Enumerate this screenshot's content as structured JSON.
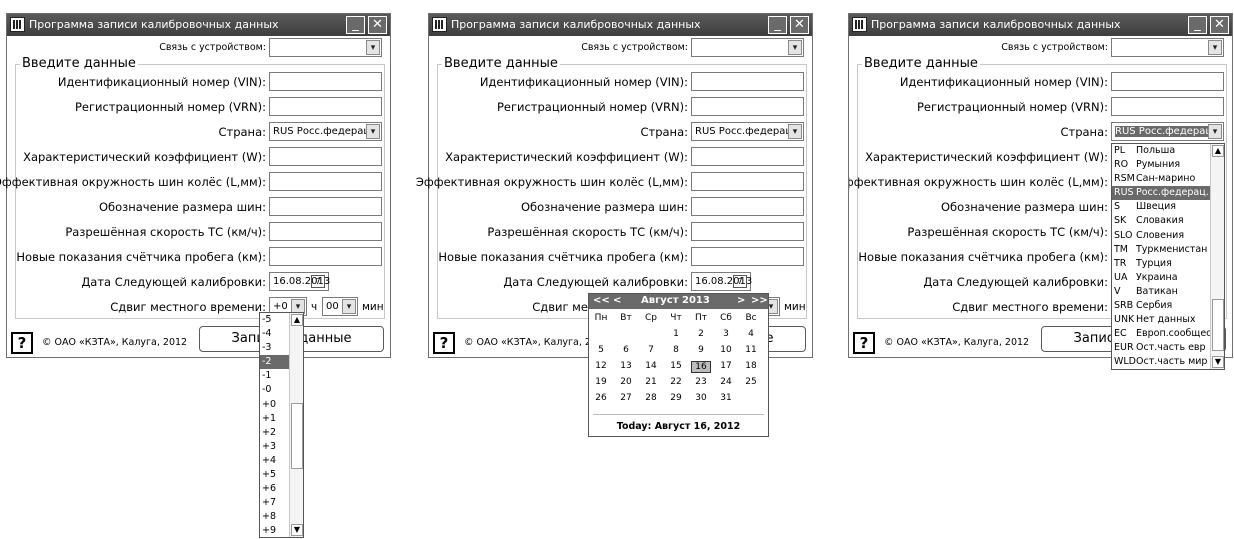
{
  "app": {
    "title": "Программа записи калибровочных данных",
    "minimize_glyph": "_",
    "close_glyph": "✕"
  },
  "form": {
    "device_label": "Связь с устройством:",
    "group_title": "Введите данные",
    "vin_label": "Идентификационный номер (VIN):",
    "vrn_label": "Регистрационный номер (VRN):",
    "country_label": "Страна:",
    "country_value": "RUS  Росс.федерац",
    "w_label": "Характеристический коэффициент (W):",
    "l_label": "Эффективная окружность шин колёс (L,мм):",
    "tire_label": "Обозначение размера шин:",
    "speed_label": "Разрешённая скорость ТС (км/ч):",
    "odometer_label": "Новые показания счётчика пробега (км):",
    "next_cal_label": "Дата Следующей калибровки:",
    "next_cal_value": "16.08.2013",
    "tz_label": "Сдвиг местного времени:",
    "tz_hours": "+0",
    "hours_unit": "ч",
    "tz_minutes": "00",
    "minutes_unit": "мин",
    "help_label": "?",
    "copyright": "© ОАО «КЗТА», Калуга, 2012",
    "record_button": "Записать данные",
    "calendar_glyph": "7",
    "dropdown_glyph": "▾"
  },
  "hour_list": {
    "items": [
      "-5",
      "-4",
      "-3",
      "-2",
      "-1",
      "-0",
      "+0",
      "+1",
      "+2",
      "+3",
      "+4",
      "+5",
      "+6",
      "+7",
      "+8",
      "+9"
    ],
    "selected_index": 3
  },
  "calendar": {
    "prev_year": "<<",
    "prev_month": "<",
    "month_year": "Август 2013",
    "next_month": ">",
    "next_year": ">>",
    "weekdays": [
      "Пн",
      "Вт",
      "Ср",
      "Чт",
      "Пт",
      "Сб",
      "Вс"
    ],
    "weeks": [
      [
        "",
        "",
        "",
        "1",
        "2",
        "3",
        "4"
      ],
      [
        "5",
        "6",
        "7",
        "8",
        "9",
        "10",
        "11"
      ],
      [
        "12",
        "13",
        "14",
        "15",
        "16",
        "17",
        "18"
      ],
      [
        "19",
        "20",
        "21",
        "22",
        "23",
        "24",
        "25"
      ],
      [
        "26",
        "27",
        "28",
        "29",
        "30",
        "31",
        ""
      ]
    ],
    "selected_day": "16",
    "today_text": "Today: Август 16, 2012"
  },
  "country_list": {
    "items": [
      {
        "code": "PL",
        "name": "Польша"
      },
      {
        "code": "RO",
        "name": "Румыния"
      },
      {
        "code": "RSM",
        "name": "Сан-марино"
      },
      {
        "code": "RUS",
        "name": "Росс.федерац."
      },
      {
        "code": "S",
        "name": "Швеция"
      },
      {
        "code": "SK",
        "name": "Словакия"
      },
      {
        "code": "SLO",
        "name": "Словения"
      },
      {
        "code": "TM",
        "name": "Туркменистан"
      },
      {
        "code": "TR",
        "name": "Турция"
      },
      {
        "code": "UA",
        "name": "Украина"
      },
      {
        "code": "V",
        "name": "Ватикан"
      },
      {
        "code": "SRB",
        "name": "Сербия"
      },
      {
        "code": "UNK",
        "name": "Нет данных"
      },
      {
        "code": "EC",
        "name": "Европ.сообщес"
      },
      {
        "code": "EUR",
        "name": "Ост.часть евр"
      },
      {
        "code": "WLD",
        "name": "Ост.часть мир"
      }
    ],
    "selected_index": 3
  }
}
